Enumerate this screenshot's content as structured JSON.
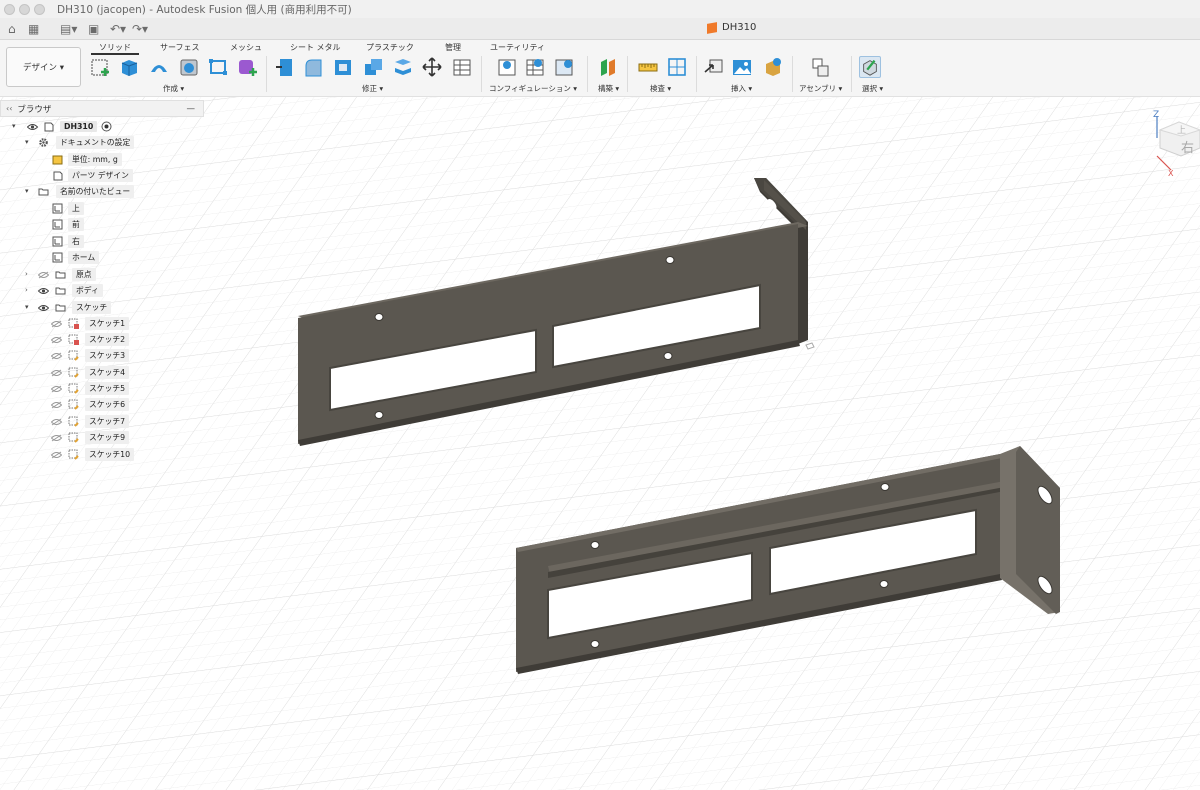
{
  "window": {
    "title": "DH310 (jacopen) - Autodesk Fusion 個人用 (商用利用不可)"
  },
  "tabbar": {
    "document_tab": "DH310"
  },
  "toolbar": {
    "workspace_button": "デザイン ▾",
    "tabs": [
      "ソリッド",
      "サーフェス",
      "メッシュ",
      "シート メタル",
      "プラスチック",
      "管理",
      "ユーティリティ"
    ],
    "groups": {
      "create": "作成 ▾",
      "modify": "修正 ▾",
      "configuration": "コンフィギュレーション ▾",
      "construct": "構築 ▾",
      "inspect": "検査 ▾",
      "insert": "挿入 ▾",
      "assembly": "アセンブリ ▾",
      "select": "選択 ▾"
    }
  },
  "browser": {
    "title": "ブラウザ",
    "root": "DH310",
    "doc_settings": "ドキュメントの設定",
    "units": "単位: mm, g",
    "part_design": "パーツ デザイン",
    "named_views": "名前の付いたビュー",
    "views": [
      "上",
      "前",
      "右",
      "ホーム"
    ],
    "origin": "原点",
    "bodies": "ボディ",
    "sketches": "スケッチ",
    "sketch_items": [
      "スケッチ1",
      "スケッチ2",
      "スケッチ3",
      "スケッチ4",
      "スケッチ5",
      "スケッチ6",
      "スケッチ7",
      "スケッチ9",
      "スケッチ10"
    ]
  },
  "viewcube": {
    "axis_z": "Z",
    "axis_x": "X",
    "face_top": "上",
    "face_right": "右"
  },
  "colors": {
    "part": "#5b5750",
    "part_dark": "#3f3c37",
    "part_light": "#77726a",
    "grid": "#e6e6e6",
    "accent_tool": "#2e8fd6"
  }
}
